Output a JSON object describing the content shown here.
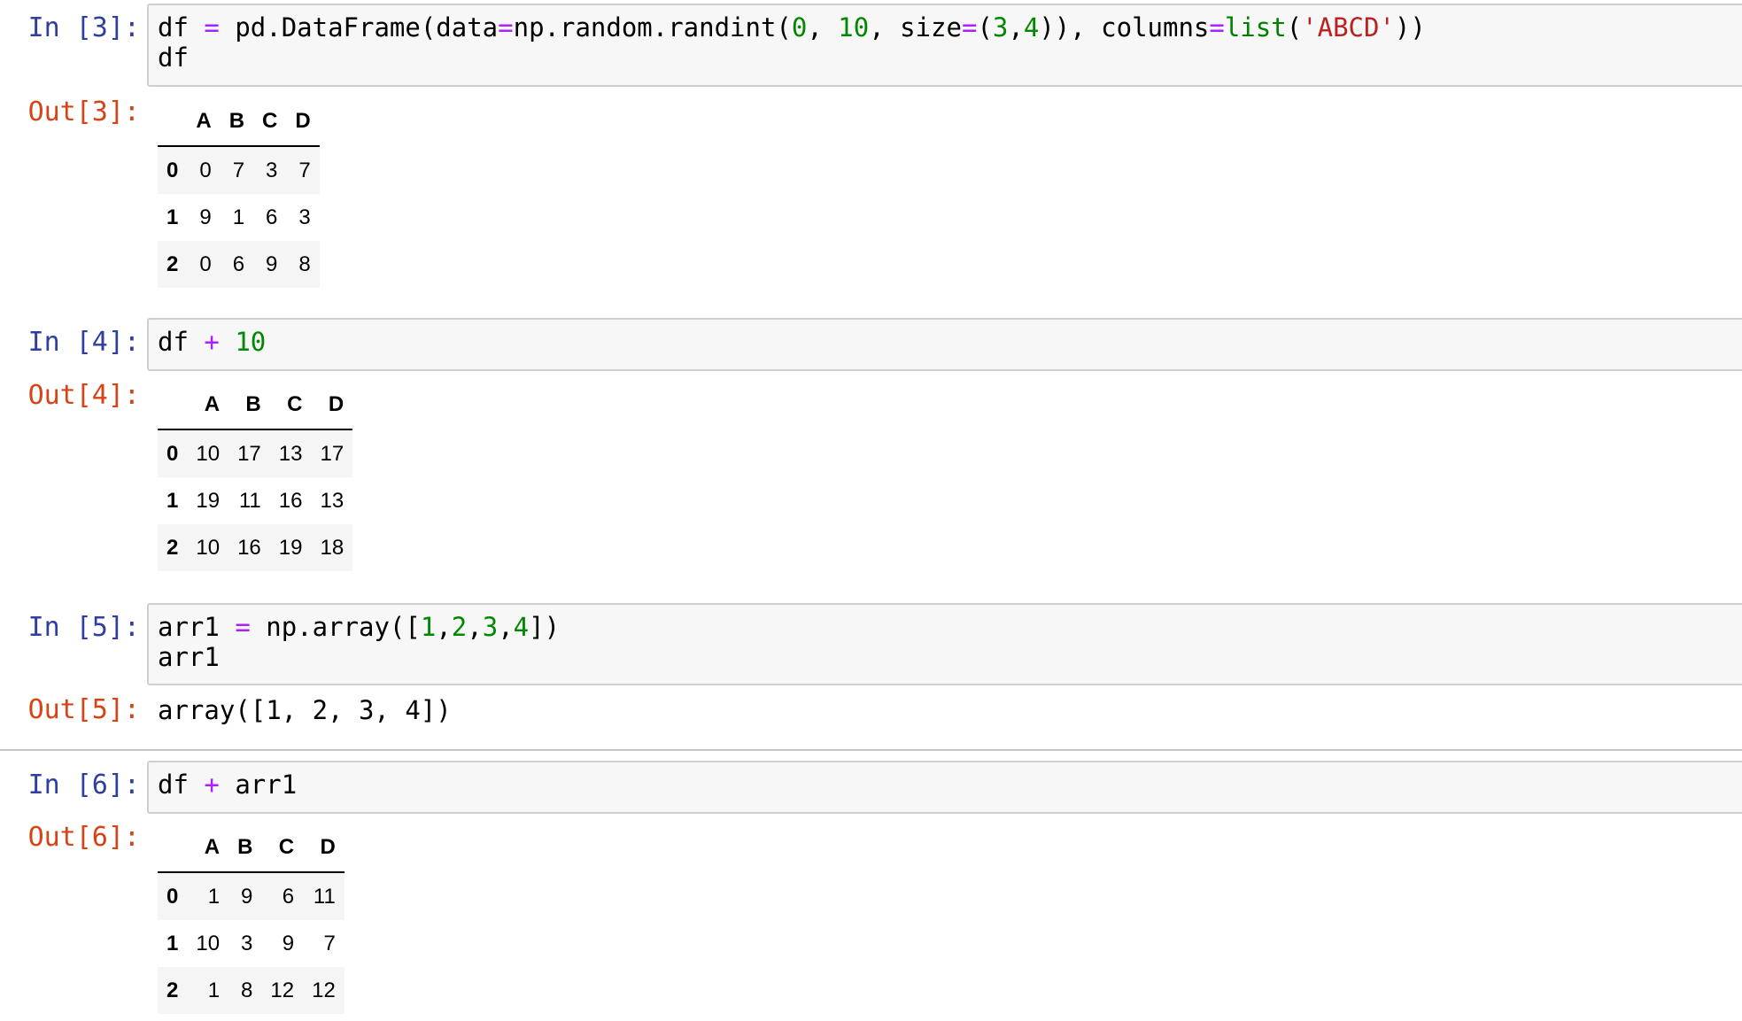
{
  "cells": [
    {
      "in_prompt": "In [3]:",
      "code": [
        [
          {
            "t": "df ",
            "c": ""
          },
          {
            "t": "=",
            "c": "op"
          },
          {
            "t": " pd.DataFrame(data",
            "c": ""
          },
          {
            "t": "=",
            "c": "op"
          },
          {
            "t": "np.random.randint(",
            "c": ""
          },
          {
            "t": "0",
            "c": "num"
          },
          {
            "t": ", ",
            "c": ""
          },
          {
            "t": "10",
            "c": "num"
          },
          {
            "t": ", size",
            "c": ""
          },
          {
            "t": "=",
            "c": "op"
          },
          {
            "t": "(",
            "c": ""
          },
          {
            "t": "3",
            "c": "num"
          },
          {
            "t": ",",
            "c": ""
          },
          {
            "t": "4",
            "c": "num"
          },
          {
            "t": ")), columns",
            "c": ""
          },
          {
            "t": "=",
            "c": "op"
          },
          {
            "t": "list",
            "c": "bi"
          },
          {
            "t": "(",
            "c": ""
          },
          {
            "t": "'ABCD'",
            "c": "str"
          },
          {
            "t": "))",
            "c": ""
          }
        ],
        [
          {
            "t": "df",
            "c": ""
          }
        ]
      ],
      "out_prompt": "Out[3]:",
      "table": {
        "columns": [
          "",
          "A",
          "B",
          "C",
          "D"
        ],
        "rows": [
          [
            "0",
            "0",
            "7",
            "3",
            "7"
          ],
          [
            "1",
            "9",
            "1",
            "6",
            "3"
          ],
          [
            "2",
            "0",
            "6",
            "9",
            "8"
          ]
        ]
      }
    },
    {
      "in_prompt": "In [4]:",
      "code": [
        [
          {
            "t": "df ",
            "c": ""
          },
          {
            "t": "+",
            "c": "op"
          },
          {
            "t": " ",
            "c": ""
          },
          {
            "t": "10",
            "c": "num"
          }
        ]
      ],
      "out_prompt": "Out[4]:",
      "table": {
        "columns": [
          "",
          "A",
          "B",
          "C",
          "D"
        ],
        "rows": [
          [
            "0",
            "10",
            "17",
            "13",
            "17"
          ],
          [
            "1",
            "19",
            "11",
            "16",
            "13"
          ],
          [
            "2",
            "10",
            "16",
            "19",
            "18"
          ]
        ]
      }
    },
    {
      "in_prompt": "In [5]:",
      "code": [
        [
          {
            "t": "arr1 ",
            "c": ""
          },
          {
            "t": "=",
            "c": "op"
          },
          {
            "t": " np.array([",
            "c": ""
          },
          {
            "t": "1",
            "c": "num"
          },
          {
            "t": ",",
            "c": ""
          },
          {
            "t": "2",
            "c": "num"
          },
          {
            "t": ",",
            "c": ""
          },
          {
            "t": "3",
            "c": "num"
          },
          {
            "t": ",",
            "c": ""
          },
          {
            "t": "4",
            "c": "num"
          },
          {
            "t": "])",
            "c": ""
          }
        ],
        [
          {
            "t": "arr1",
            "c": ""
          }
        ]
      ],
      "out_prompt": "Out[5]:",
      "out_text": "array([1, 2, 3, 4])"
    },
    {
      "in_prompt": "In [6]:",
      "code": [
        [
          {
            "t": "df ",
            "c": ""
          },
          {
            "t": "+",
            "c": "op"
          },
          {
            "t": " arr1",
            "c": ""
          }
        ]
      ],
      "out_prompt": "Out[6]:",
      "table": {
        "columns": [
          "",
          "A",
          "B",
          "C",
          "D"
        ],
        "rows": [
          [
            "0",
            "1",
            "9",
            "6",
            "11"
          ],
          [
            "1",
            "10",
            "3",
            "9",
            "7"
          ],
          [
            "2",
            "1",
            "8",
            "12",
            "12"
          ]
        ]
      }
    }
  ],
  "colors": {
    "in_prompt": "#303f9f",
    "out_prompt": "#d84315",
    "operator": "#aa22ff",
    "number": "#008800",
    "string": "#ba2121",
    "builtin": "#008000",
    "input_bg": "#f7f7f7"
  }
}
